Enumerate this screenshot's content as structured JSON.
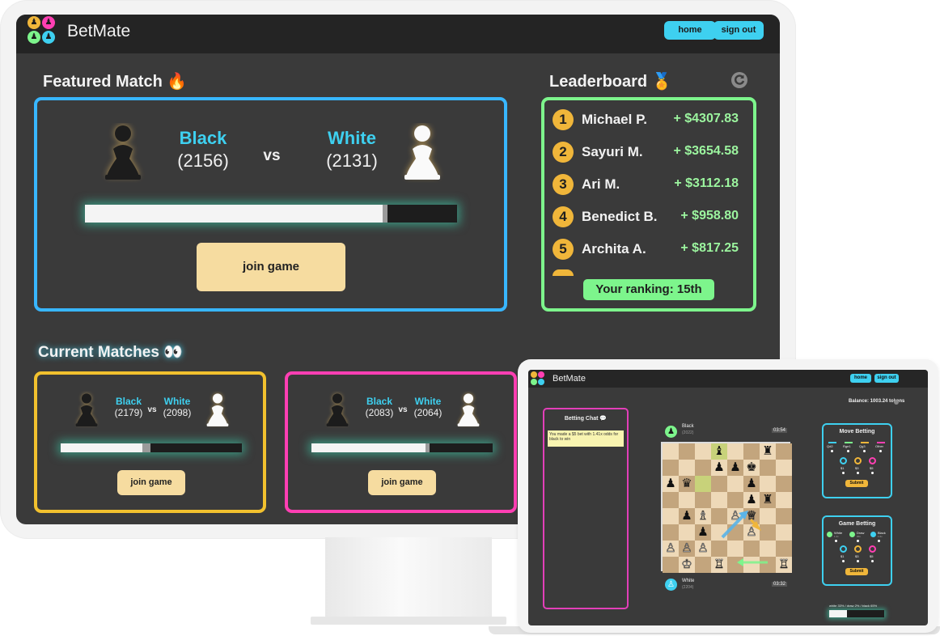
{
  "app": {
    "brand": "BetMate"
  },
  "colors": {
    "accent": "#3ed0f0",
    "featured_border": "#38b6ff",
    "leaderboard_border": "#7df58c",
    "match1_border": "#f2c12e",
    "match2_border": "#ff3fb3",
    "join_button": "#f6dca0",
    "gold": "#f0b63a"
  },
  "nav": {
    "home": "home",
    "signout": "sign out"
  },
  "featured": {
    "title": "Featured Match 🔥",
    "black_name": "Black",
    "black_rating": "(2156)",
    "white_name": "White",
    "white_rating": "(2131)",
    "vs": "vs",
    "white_share": 0.8,
    "join": "join game"
  },
  "leaderboard": {
    "title": "Leaderboard 🏅",
    "refresh_icon": "refresh-icon",
    "entries": [
      {
        "rank": "1",
        "name": "Michael P.",
        "amount": "+ $4307.83"
      },
      {
        "rank": "2",
        "name": "Sayuri M.",
        "amount": "+ $3654.58"
      },
      {
        "rank": "3",
        "name": "Ari M.",
        "amount": "+ $3112.18"
      },
      {
        "rank": "4",
        "name": "Benedict B.",
        "amount": "+ $958.80"
      },
      {
        "rank": "5",
        "name": "Archita A.",
        "amount": "+ $817.25"
      }
    ],
    "your_ranking": "Your ranking: 15th"
  },
  "current": {
    "title": "Current Matches 👀",
    "matches": [
      {
        "black_name": "Black",
        "black_rating": "(2179)",
        "white_name": "White",
        "white_rating": "(2098)",
        "vs": "vs",
        "white_share": 0.45,
        "join": "join game"
      },
      {
        "black_name": "Black",
        "black_rating": "(2083)",
        "white_name": "White",
        "white_rating": "(2064)",
        "vs": "vs",
        "white_share": 0.63,
        "join": "join game"
      }
    ]
  },
  "laptop": {
    "brand": "BetMate",
    "nav": {
      "home": "home",
      "signout": "sign out"
    },
    "balance": "Balance: 1003.24 tokens",
    "chat": {
      "title": "Betting Chat 💬",
      "message": "You made a $5 bet with 1.41x odds for black to win"
    },
    "black_player": {
      "name": "Black",
      "rating": "(2022)",
      "clock": "03:54"
    },
    "white_player": {
      "name": "White",
      "rating": "(2204)",
      "clock": "03:32"
    },
    "move_betting": {
      "title": "Move Betting",
      "moves": [
        "Qd2",
        "Rge1",
        "Qg3",
        "Other"
      ],
      "stakes": [
        "$1",
        "$3",
        "$5"
      ],
      "submit": "Submit"
    },
    "game_betting": {
      "title": "Game Betting",
      "outcomes": [
        "White",
        "Draw",
        "Black"
      ],
      "odds": [
        "1.4x",
        "20x",
        "1.6x"
      ],
      "stakes": [
        "$1",
        "$3",
        "$5"
      ],
      "submit": "Submit"
    },
    "odds_text": "white 33% / draw 2% / black 65%",
    "white_share": 0.33,
    "board": [
      [
        "",
        "",
        "",
        "♝",
        "",
        "",
        "♜",
        ""
      ],
      [
        "",
        "",
        "",
        "♟",
        "♟",
        "♚",
        "",
        ""
      ],
      [
        "♟",
        "♛",
        "",
        "",
        "",
        "♟",
        "",
        ""
      ],
      [
        "",
        "",
        "",
        "",
        "",
        "♟",
        "♜",
        ""
      ],
      [
        "",
        "♟",
        "♗",
        "",
        "♙",
        "♕",
        "",
        ""
      ],
      [
        "",
        "",
        "♟",
        "",
        "",
        "♙",
        "",
        ""
      ],
      [
        "♙",
        "♙",
        "♙",
        "",
        "",
        "",
        "",
        ""
      ],
      [
        "",
        "♔",
        "",
        "♖",
        "",
        "",
        "",
        "♖"
      ]
    ]
  }
}
